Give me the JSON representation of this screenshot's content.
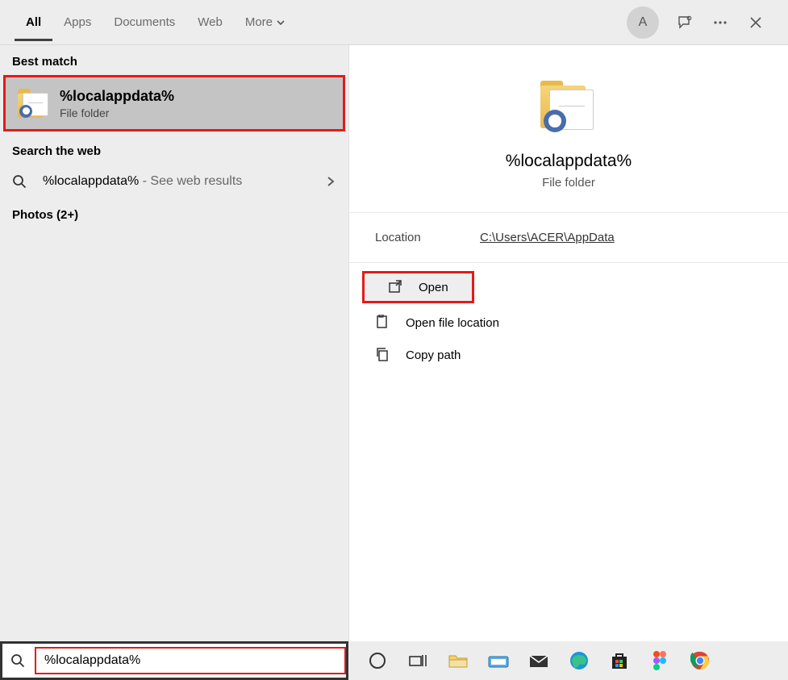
{
  "tabs": {
    "all": "All",
    "apps": "Apps",
    "documents": "Documents",
    "web": "Web",
    "more": "More"
  },
  "avatar_letter": "A",
  "sections": {
    "best_match": "Best match",
    "search_web": "Search the web",
    "photos": "Photos (2+)"
  },
  "best_match": {
    "title": "%localappdata%",
    "subtitle": "File folder"
  },
  "web_result": {
    "query": "%localappdata%",
    "suffix": " - See web results"
  },
  "preview": {
    "title": "%localappdata%",
    "subtitle": "File folder"
  },
  "location": {
    "label": "Location",
    "value": "C:\\Users\\ACER\\AppData"
  },
  "actions": {
    "open": "Open",
    "open_file_location": "Open file location",
    "copy_path": "Copy path"
  },
  "search": {
    "value": "%localappdata%"
  }
}
